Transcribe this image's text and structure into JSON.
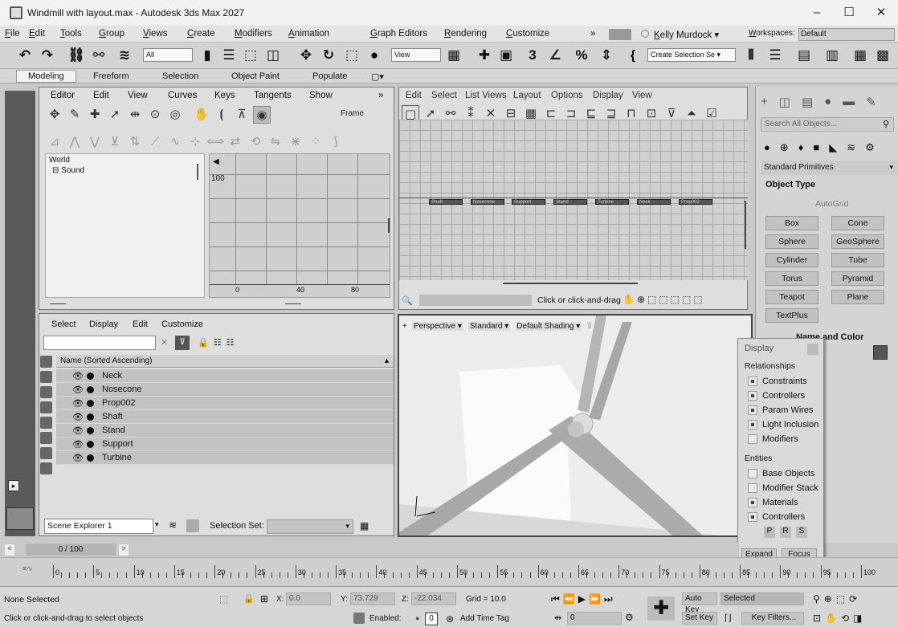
{
  "app": {
    "title": "Windmill with layout.max - Autodesk 3ds Max 2027",
    "minimize": "–",
    "maximize": "☐",
    "close": "✕"
  },
  "menu": {
    "items": [
      "File",
      "Edit",
      "Tools",
      "Group",
      "Views",
      "Create",
      "Modifiers",
      "Animation",
      "Graph Editors",
      "Rendering",
      "Customize"
    ],
    "more": "»",
    "user": "Kelly Murdock ▾",
    "workspaces_label": "Workspaces:",
    "workspace_value": "Default"
  },
  "toolbar": {
    "filter_value": "All",
    "view_value": "View",
    "create_selection": "Create Selection Se ▾"
  },
  "ribbon": {
    "tabs": [
      "Modeling",
      "Freeform",
      "Selection",
      "Object Paint",
      "Populate"
    ],
    "more": "▢▾"
  },
  "curve_editor": {
    "menu": [
      "Editor",
      "Edit",
      "View",
      "Curves",
      "Keys",
      "Tangents",
      "Show"
    ],
    "more": "»",
    "frame_label": "Frame",
    "tree_world": "World",
    "tree_sound": "⊟ Sound",
    "y_value": "100",
    "ruler": [
      "0",
      "40",
      "80"
    ]
  },
  "dope_sheet": {
    "menu": [
      "Edit",
      "Select",
      "List Views",
      "Layout",
      "Options",
      "Display",
      "View"
    ],
    "nodes": [
      "Shaft",
      "Nosecone",
      "Support",
      "Stand",
      "Turbine",
      "Neck",
      "Prop002"
    ],
    "hint": "Click or click-and-drag"
  },
  "scene_explorer": {
    "menu": [
      "Select",
      "Display",
      "Edit",
      "Customize"
    ],
    "column_header": "Name (Sorted Ascending)",
    "rows": [
      "Neck",
      "Nosecone",
      "Prop002",
      "Shaft",
      "Stand",
      "Support",
      "Turbine"
    ],
    "explorer_name": "Scene Explorer 1",
    "selection_set_label": "Selection Set:"
  },
  "viewport": {
    "labels": [
      "+",
      "Perspective ▾",
      "Standard ▾",
      "Default Shading ▾"
    ]
  },
  "command_panel": {
    "search_placeholder": "Search All Objects...",
    "category": "Standard Primitives",
    "rollout_object_type": "Object Type",
    "autogrid": "AutoGrid",
    "buttons": [
      "Box",
      "Cone",
      "Sphere",
      "GeoSphere",
      "Cylinder",
      "Tube",
      "Torus",
      "Pyramid",
      "Teapot",
      "Plane",
      "TextPlus"
    ],
    "rollout_name_color": "Name and Color"
  },
  "display_popup": {
    "title": "Display",
    "relationships_label": "Relationships",
    "relationships": [
      {
        "label": "Constraints",
        "checked": true
      },
      {
        "label": "Controllers",
        "checked": true
      },
      {
        "label": "Param Wires",
        "checked": true
      },
      {
        "label": "Light Inclusion",
        "checked": true
      },
      {
        "label": "Modifiers",
        "checked": false
      }
    ],
    "entities_label": "Entities",
    "entities": [
      {
        "label": "Base Objects",
        "checked": false
      },
      {
        "label": "Modifier Stack",
        "checked": false
      },
      {
        "label": "Materials",
        "checked": true
      },
      {
        "label": "Controllers",
        "checked": true
      }
    ],
    "prs": [
      "P",
      "R",
      "S"
    ],
    "expand": "Expand",
    "focus": "Focus"
  },
  "timeline": {
    "frame": "0 / 100",
    "ticks": [
      "0",
      "5",
      "10",
      "15",
      "20",
      "25",
      "30",
      "35",
      "40",
      "45",
      "50",
      "55",
      "60",
      "65",
      "70",
      "75",
      "80",
      "85",
      "90",
      "95",
      "100"
    ]
  },
  "status": {
    "selection": "None Selected",
    "prompt": "Click or click-and-drag to select objects",
    "x_label": "X:",
    "x_value": "0.0",
    "y_label": "Y:",
    "y_value": "73.729",
    "z_label": "Z:",
    "z_value": "-22.034",
    "grid": "Grid = 10.0",
    "enabled_label": "Enabled:",
    "add_time_tag": "Add Time Tag",
    "auto_key": "Auto Key",
    "set_key": "Set Key",
    "key_selected": "Selected",
    "key_filters": "Key Filters...",
    "frame_value": "0"
  }
}
